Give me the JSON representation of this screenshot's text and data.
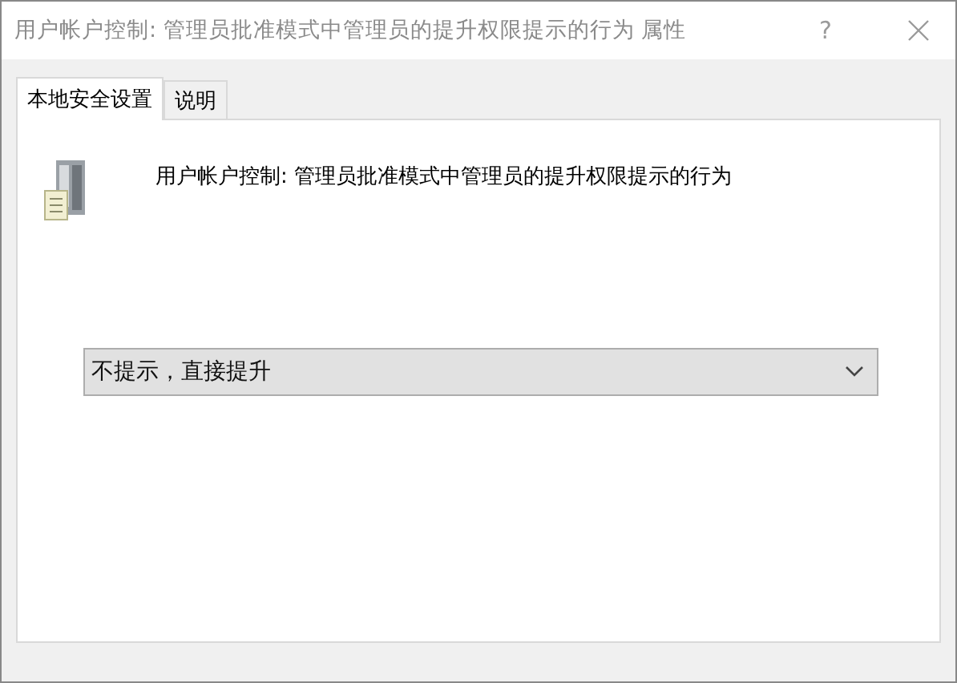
{
  "window": {
    "title": "用户帐户控制: 管理员批准模式中管理员的提升权限提示的行为 属性",
    "help": "?"
  },
  "tabs": [
    {
      "label": "本地安全设置",
      "selected": true
    },
    {
      "label": "说明",
      "selected": false
    }
  ],
  "policy": {
    "title": "用户帐户控制: 管理员批准模式中管理员的提升权限提示的行为"
  },
  "dropdown": {
    "value": "不提示，直接提升"
  }
}
